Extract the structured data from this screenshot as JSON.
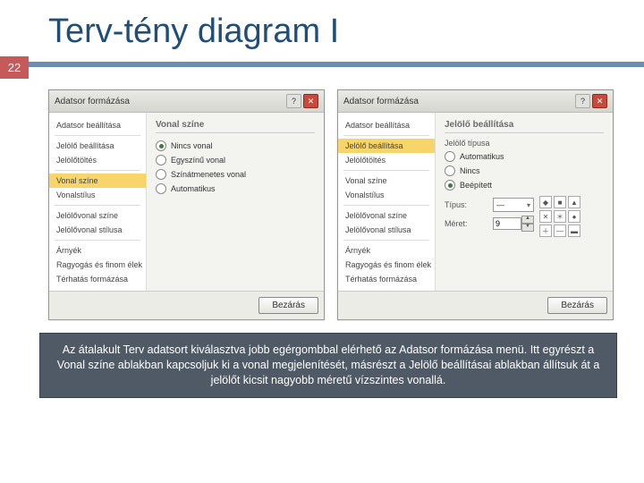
{
  "slide": {
    "title": "Terv-tény diagram I",
    "page": "22"
  },
  "dialog_left": {
    "title": "Adatsor formázása",
    "side": [
      "Adatsor beállítása",
      "Jelölő beállítása",
      "Jelölőtöltés",
      "Vonal színe",
      "Vonalstílus",
      "Jelölővonal színe",
      "Jelölővonal stílusa",
      "Árnyék",
      "Ragyogás és finom élek",
      "Térhatás formázása"
    ],
    "selected": 3,
    "pane_heading": "Vonal színe",
    "radios": [
      "Nincs vonal",
      "Egyszínű vonal",
      "Színátmenetes vonal",
      "Automatikus"
    ],
    "radio_selected": 0,
    "close_btn": "Bezárás"
  },
  "dialog_right": {
    "title": "Adatsor formázása",
    "side": [
      "Adatsor beállítása",
      "Jelölő beállítása",
      "Jelölőtöltés",
      "Vonal színe",
      "Vonalstílus",
      "Jelölővonal színe",
      "Jelölővonal stílusa",
      "Árnyék",
      "Ragyogás és finom élek",
      "Térhatás formázása"
    ],
    "selected": 1,
    "pane_heading": "Jelölő beállítása",
    "section_label": "Jelölő típusa",
    "radios": [
      "Automatikus",
      "Nincs",
      "Beépített"
    ],
    "radio_selected": 2,
    "type_label": "Típus:",
    "type_value": "—",
    "size_label": "Méret:",
    "size_value": "9",
    "close_btn": "Bezárás"
  },
  "caption": "Az átalakult Terv adatsort kiválasztva jobb egérgombbal elérhető az Adatsor formázása menü. Itt egyrészt a Vonal színe ablakban kapcsoljuk ki a vonal megjelenítését, másrészt a Jelölő beállításai ablakban állítsuk át a jelölőt kicsit nagyobb méretű vízszintes vonallá."
}
